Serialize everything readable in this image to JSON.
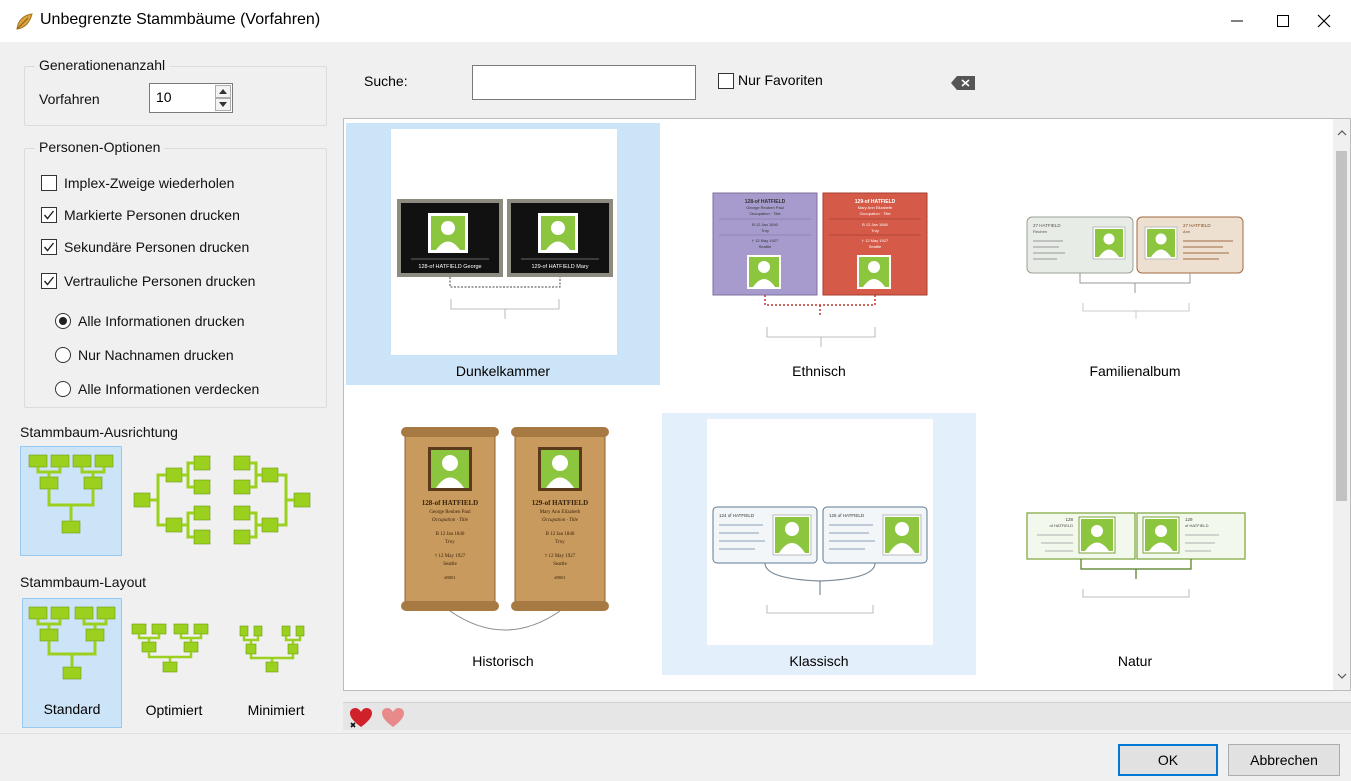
{
  "window": {
    "title": "Unbegrenzte Stammbäume (Vorfahren)"
  },
  "generations": {
    "group_label": "Generationenanzahl",
    "ancestors_label": "Vorfahren",
    "ancestors_value": "10"
  },
  "person_options": {
    "group_label": "Personen-Optionen",
    "checkboxes": [
      {
        "label": "Implex-Zweige wiederholen",
        "checked": false
      },
      {
        "label": "Markierte Personen drucken",
        "checked": true
      },
      {
        "label": "Sekundäre Personen drucken",
        "checked": true
      },
      {
        "label": "Vertrauliche Personen drucken",
        "checked": true
      }
    ],
    "radios": [
      {
        "label": "Alle Informationen drucken",
        "selected": true
      },
      {
        "label": "Nur Nachnamen drucken",
        "selected": false
      },
      {
        "label": "Alle Informationen verdecken",
        "selected": false
      }
    ]
  },
  "orientation": {
    "title": "Stammbaum-Ausrichtung",
    "selected_index": 0
  },
  "layout": {
    "title": "Stammbaum-Layout",
    "options": [
      "Standard",
      "Optimiert",
      "Minimiert"
    ],
    "selected_index": 0
  },
  "search": {
    "label": "Suche:",
    "value": "",
    "favorites_label": "Nur Favoriten",
    "favorites_checked": false
  },
  "templates": [
    {
      "name": "Dunkelkammer",
      "selected": true
    },
    {
      "name": "Ethnisch",
      "selected": false
    },
    {
      "name": "Familienalbum",
      "selected": false
    },
    {
      "name": "Historisch",
      "selected": false
    },
    {
      "name": "Klassisch",
      "selected": false
    },
    {
      "name": "Natur",
      "selected": false
    }
  ],
  "thumbnails": {
    "dunkelkammer": {
      "left": "128-of HATFIELD George",
      "right": "129-of HATFIELD Mary"
    },
    "ethnisch": {
      "left_title": "128-of HATFIELD",
      "left_name": "George Reuben Paul",
      "right_title": "129-of HATFIELD",
      "right_name": "Mary Ann Elizabeth",
      "occupation": "Occupation · Title",
      "born": "B 12 Jan 1840",
      "place": "Troy",
      "died": "† 12 May 1927",
      "death_place": "Seattle"
    },
    "familienalbum": {
      "left": "27 HATFIELD",
      "left_sub": "Reuben",
      "right": "27 HATFIELD",
      "right_sub": "Ann"
    },
    "historisch": {
      "left_title": "128-of HATFIELD",
      "left_name": "George Reuben Paul",
      "right_title": "129-of HATFIELD",
      "right_name": "Mary Ann Elizabeth",
      "occupation": "Occupation · Title",
      "born": "B 12 Jan 1840",
      "place": "Troy",
      "died": "† 12 May 1927",
      "death_place": "Seattle",
      "id": "#0001"
    },
    "klassisch": {
      "left": "124 of HATFIELD",
      "right": "125 of HATFIELD"
    },
    "natur": {
      "left": "128",
      "left_sub": "of HATFIELD",
      "right": "129",
      "right_sub": "of HATFIELD"
    }
  },
  "buttons": {
    "ok": "OK",
    "cancel": "Abbrechen"
  },
  "colors": {
    "selection": "#cce4f7",
    "accent": "#0078d7",
    "tree_green": "#8cc63f"
  }
}
